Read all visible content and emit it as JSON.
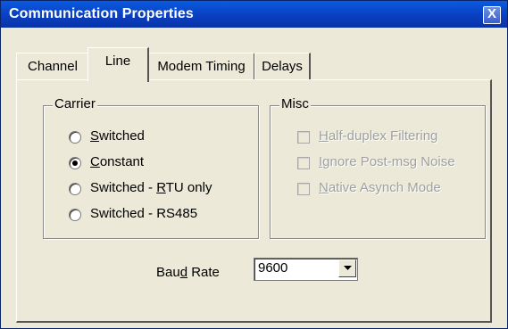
{
  "window": {
    "title": "Communication Properties",
    "close_glyph": "X"
  },
  "tabs": [
    {
      "label": "Channel",
      "active": false
    },
    {
      "label": "Line",
      "active": true
    },
    {
      "label": "Modem Timing",
      "active": false
    },
    {
      "label": "Delays",
      "active": false
    }
  ],
  "carrier": {
    "label": "Carrier",
    "options": [
      {
        "pre": "",
        "key": "S",
        "post": "witched",
        "selected": false
      },
      {
        "pre": "",
        "key": "C",
        "post": "onstant",
        "selected": true
      },
      {
        "pre": "Switched - ",
        "key": "R",
        "post": "TU only",
        "selected": false
      },
      {
        "pre": "Switched - RS485",
        "key": "",
        "post": "",
        "selected": false
      }
    ]
  },
  "misc": {
    "label": "Misc",
    "options": [
      {
        "pre": "",
        "key": "H",
        "post": "alf-duplex Filtering",
        "checked": false,
        "enabled": false
      },
      {
        "pre": "",
        "key": "I",
        "post": "gnore Post-msg Noise",
        "checked": false,
        "enabled": false
      },
      {
        "pre": "",
        "key": "N",
        "post": "ative Asynch Mode",
        "checked": false,
        "enabled": false
      }
    ]
  },
  "baud": {
    "label_pre": "Bau",
    "label_key": "d",
    "label_post": " Rate",
    "value": "9600"
  },
  "icons": {
    "close": "close-icon",
    "dropdown": "chevron-down-icon"
  }
}
